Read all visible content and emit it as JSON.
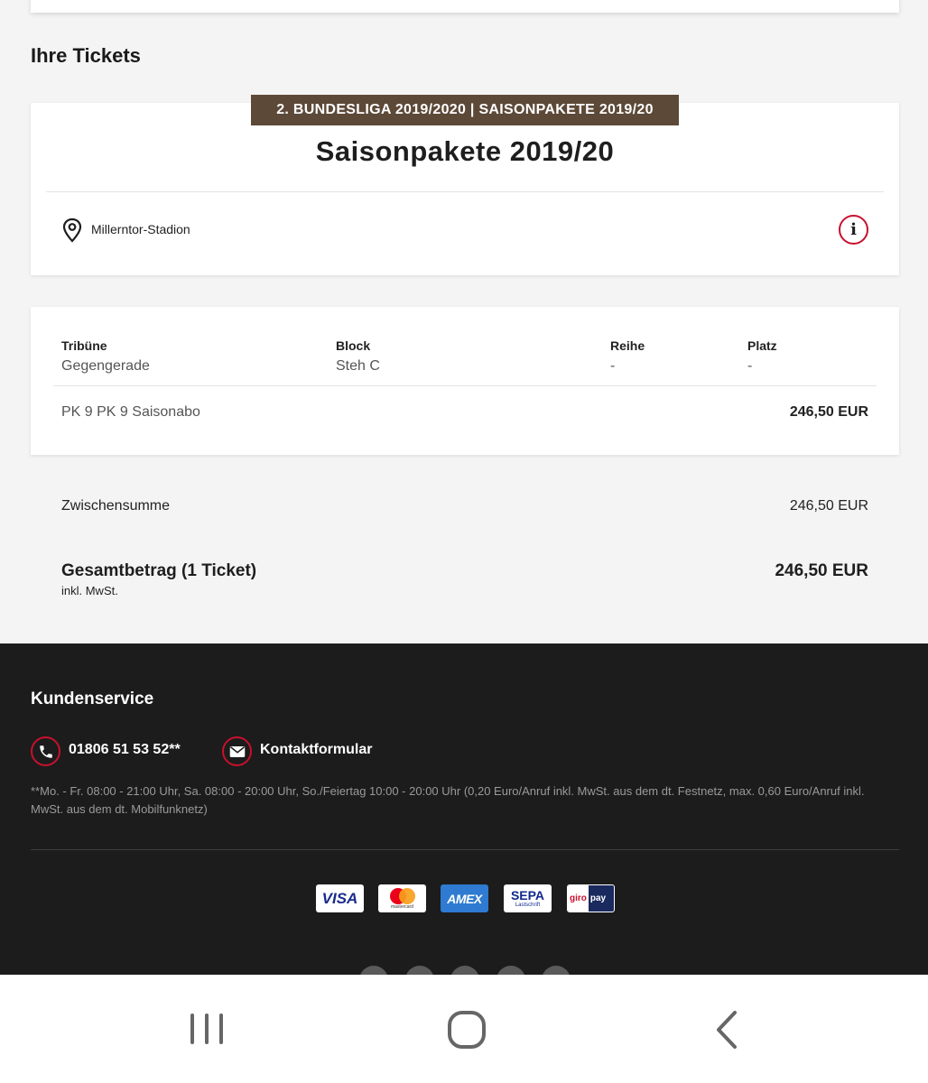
{
  "tickets": {
    "section_title": "Ihre Tickets",
    "event": {
      "tag": "2. BUNDESLIGA 2019/2020 | SAISONPAKETE 2019/20",
      "title": "Saisonpakete 2019/20",
      "venue": "Millerntor-Stadion",
      "venue_icon": "location-pin-icon",
      "info_icon": "info-icon"
    },
    "seat": {
      "columns": [
        {
          "label": "Tribüne",
          "value": "Gegengerade"
        },
        {
          "label": "Block",
          "value": "Steh C"
        },
        {
          "label": "Reihe",
          "value": "-"
        },
        {
          "label": "Platz",
          "value": "-"
        }
      ],
      "product": "PK 9 PK 9 Saisonabo",
      "price": "246,50 EUR"
    },
    "subtotal": {
      "label": "Zwischensumme",
      "value": "246,50 EUR"
    },
    "total": {
      "label": "Gesamtbetrag (1 Ticket)",
      "sublabel": "inkl. MwSt.",
      "value": "246,50 EUR"
    }
  },
  "footer": {
    "title": "Kundenservice",
    "phone": {
      "text": "01806 51 53 52**",
      "icon": "phone-icon"
    },
    "contact": {
      "text": "Kontaktformular",
      "icon": "mail-icon"
    },
    "footnote": "**Mo. - Fr. 08:00 - 21:00 Uhr, Sa. 08:00 - 20:00 Uhr, So./Feiertag 10:00 - 20:00 Uhr (0,20 Euro/Anruf inkl. MwSt. aus dem dt. Festnetz, max. 0,60 Euro/Anruf inkl. MwSt. aus dem dt. Mobilfunknetz)",
    "payment_methods": [
      {
        "name": "visa",
        "text": "VISA"
      },
      {
        "name": "mastercard",
        "text": "mastercard"
      },
      {
        "name": "amex",
        "text": "AMEX"
      },
      {
        "name": "sepa",
        "text": "SEPA",
        "subtext": "Lastschrift"
      },
      {
        "name": "giropay",
        "text_a": "giro",
        "text_b": "pay"
      }
    ]
  },
  "navbar": {
    "recents_icon": "recent-apps-icon",
    "home_icon": "home-icon",
    "back_icon": "back-icon"
  },
  "colors": {
    "accent_red": "#c8102e",
    "tag_brown": "#5d4938",
    "footer_bg": "#1c1c1c",
    "page_bg": "#f4f4f4"
  }
}
